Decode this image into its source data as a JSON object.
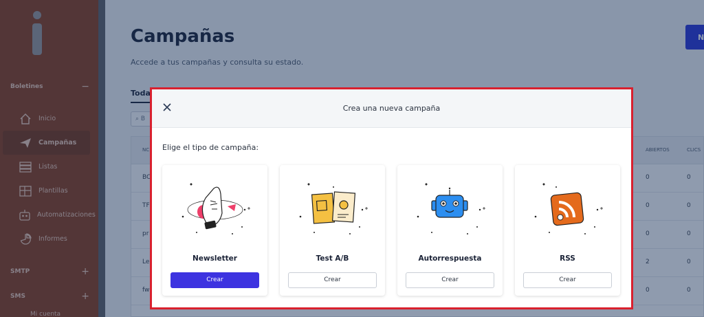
{
  "sidebar": {
    "sections": {
      "boletines": "Boletines",
      "smtp": "SMTP",
      "sms": "SMS",
      "mi_cuenta": "Mi cuenta"
    },
    "items": [
      {
        "label": "Inicio",
        "icon": "home-icon"
      },
      {
        "label": "Campañas",
        "icon": "paper-plane-icon",
        "active": true
      },
      {
        "label": "Listas",
        "icon": "list-icon"
      },
      {
        "label": "Plantillas",
        "icon": "template-icon"
      },
      {
        "label": "Automatizaciones",
        "icon": "robot-icon"
      },
      {
        "label": "Informes",
        "icon": "chart-icon"
      }
    ]
  },
  "page": {
    "title": "Campañas",
    "subtitle": "Accede a tus campañas y consulta su estado.",
    "new_button": "N",
    "tab_all": "Todas",
    "search_placeholder": "B",
    "table": {
      "headers": [
        "NC",
        "ABIERTOS",
        "CLICS"
      ],
      "rows": [
        {
          "name": "BC",
          "opened": "0",
          "clicks": "0"
        },
        {
          "name": "TF",
          "opened": "0",
          "clicks": "0"
        },
        {
          "name": "pr",
          "opened": "0",
          "clicks": "0"
        },
        {
          "name": "Le",
          "opened": "2",
          "clicks": "0"
        },
        {
          "name": "fw",
          "opened": "0",
          "clicks": "0"
        }
      ]
    }
  },
  "modal": {
    "title": "Crea una nueva campaña",
    "prompt": "Elige el tipo de campaña:",
    "cards": [
      {
        "label": "Newsletter",
        "button": "Crear",
        "icon": "newsletter-illustration"
      },
      {
        "label": "Test A/B",
        "button": "Crear",
        "icon": "ab-test-illustration"
      },
      {
        "label": "Autorrespuesta",
        "button": "Crear",
        "icon": "robot-illustration"
      },
      {
        "label": "RSS",
        "button": "Crear",
        "icon": "rss-illustration"
      }
    ]
  },
  "colors": {
    "sidebar_bg": "#8c3f1c",
    "primary_button": "#3d33e0",
    "highlight_border": "#d9202e",
    "ab_yellow": "#f4c042",
    "robot_blue": "#2c8ef0",
    "rss_orange": "#e46a1c"
  }
}
